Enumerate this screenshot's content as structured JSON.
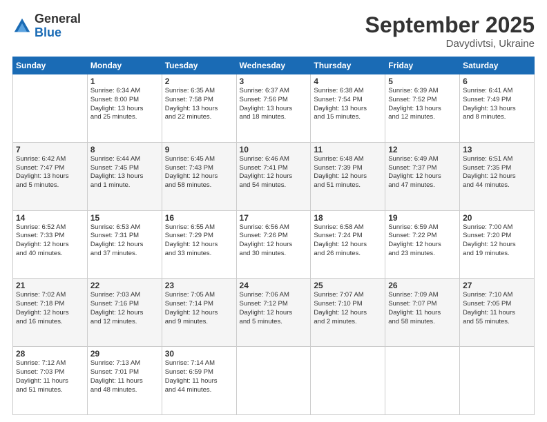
{
  "logo": {
    "general": "General",
    "blue": "Blue"
  },
  "header": {
    "month": "September 2025",
    "location": "Davydivtsi, Ukraine"
  },
  "weekdays": [
    "Sunday",
    "Monday",
    "Tuesday",
    "Wednesday",
    "Thursday",
    "Friday",
    "Saturday"
  ],
  "weeks": [
    [
      {
        "day": "",
        "info": ""
      },
      {
        "day": "1",
        "info": "Sunrise: 6:34 AM\nSunset: 8:00 PM\nDaylight: 13 hours\nand 25 minutes."
      },
      {
        "day": "2",
        "info": "Sunrise: 6:35 AM\nSunset: 7:58 PM\nDaylight: 13 hours\nand 22 minutes."
      },
      {
        "day": "3",
        "info": "Sunrise: 6:37 AM\nSunset: 7:56 PM\nDaylight: 13 hours\nand 18 minutes."
      },
      {
        "day": "4",
        "info": "Sunrise: 6:38 AM\nSunset: 7:54 PM\nDaylight: 13 hours\nand 15 minutes."
      },
      {
        "day": "5",
        "info": "Sunrise: 6:39 AM\nSunset: 7:52 PM\nDaylight: 13 hours\nand 12 minutes."
      },
      {
        "day": "6",
        "info": "Sunrise: 6:41 AM\nSunset: 7:49 PM\nDaylight: 13 hours\nand 8 minutes."
      }
    ],
    [
      {
        "day": "7",
        "info": "Sunrise: 6:42 AM\nSunset: 7:47 PM\nDaylight: 13 hours\nand 5 minutes."
      },
      {
        "day": "8",
        "info": "Sunrise: 6:44 AM\nSunset: 7:45 PM\nDaylight: 13 hours\nand 1 minute."
      },
      {
        "day": "9",
        "info": "Sunrise: 6:45 AM\nSunset: 7:43 PM\nDaylight: 12 hours\nand 58 minutes."
      },
      {
        "day": "10",
        "info": "Sunrise: 6:46 AM\nSunset: 7:41 PM\nDaylight: 12 hours\nand 54 minutes."
      },
      {
        "day": "11",
        "info": "Sunrise: 6:48 AM\nSunset: 7:39 PM\nDaylight: 12 hours\nand 51 minutes."
      },
      {
        "day": "12",
        "info": "Sunrise: 6:49 AM\nSunset: 7:37 PM\nDaylight: 12 hours\nand 47 minutes."
      },
      {
        "day": "13",
        "info": "Sunrise: 6:51 AM\nSunset: 7:35 PM\nDaylight: 12 hours\nand 44 minutes."
      }
    ],
    [
      {
        "day": "14",
        "info": "Sunrise: 6:52 AM\nSunset: 7:33 PM\nDaylight: 12 hours\nand 40 minutes."
      },
      {
        "day": "15",
        "info": "Sunrise: 6:53 AM\nSunset: 7:31 PM\nDaylight: 12 hours\nand 37 minutes."
      },
      {
        "day": "16",
        "info": "Sunrise: 6:55 AM\nSunset: 7:29 PM\nDaylight: 12 hours\nand 33 minutes."
      },
      {
        "day": "17",
        "info": "Sunrise: 6:56 AM\nSunset: 7:26 PM\nDaylight: 12 hours\nand 30 minutes."
      },
      {
        "day": "18",
        "info": "Sunrise: 6:58 AM\nSunset: 7:24 PM\nDaylight: 12 hours\nand 26 minutes."
      },
      {
        "day": "19",
        "info": "Sunrise: 6:59 AM\nSunset: 7:22 PM\nDaylight: 12 hours\nand 23 minutes."
      },
      {
        "day": "20",
        "info": "Sunrise: 7:00 AM\nSunset: 7:20 PM\nDaylight: 12 hours\nand 19 minutes."
      }
    ],
    [
      {
        "day": "21",
        "info": "Sunrise: 7:02 AM\nSunset: 7:18 PM\nDaylight: 12 hours\nand 16 minutes."
      },
      {
        "day": "22",
        "info": "Sunrise: 7:03 AM\nSunset: 7:16 PM\nDaylight: 12 hours\nand 12 minutes."
      },
      {
        "day": "23",
        "info": "Sunrise: 7:05 AM\nSunset: 7:14 PM\nDaylight: 12 hours\nand 9 minutes."
      },
      {
        "day": "24",
        "info": "Sunrise: 7:06 AM\nSunset: 7:12 PM\nDaylight: 12 hours\nand 5 minutes."
      },
      {
        "day": "25",
        "info": "Sunrise: 7:07 AM\nSunset: 7:10 PM\nDaylight: 12 hours\nand 2 minutes."
      },
      {
        "day": "26",
        "info": "Sunrise: 7:09 AM\nSunset: 7:07 PM\nDaylight: 11 hours\nand 58 minutes."
      },
      {
        "day": "27",
        "info": "Sunrise: 7:10 AM\nSunset: 7:05 PM\nDaylight: 11 hours\nand 55 minutes."
      }
    ],
    [
      {
        "day": "28",
        "info": "Sunrise: 7:12 AM\nSunset: 7:03 PM\nDaylight: 11 hours\nand 51 minutes."
      },
      {
        "day": "29",
        "info": "Sunrise: 7:13 AM\nSunset: 7:01 PM\nDaylight: 11 hours\nand 48 minutes."
      },
      {
        "day": "30",
        "info": "Sunrise: 7:14 AM\nSunset: 6:59 PM\nDaylight: 11 hours\nand 44 minutes."
      },
      {
        "day": "",
        "info": ""
      },
      {
        "day": "",
        "info": ""
      },
      {
        "day": "",
        "info": ""
      },
      {
        "day": "",
        "info": ""
      }
    ]
  ]
}
